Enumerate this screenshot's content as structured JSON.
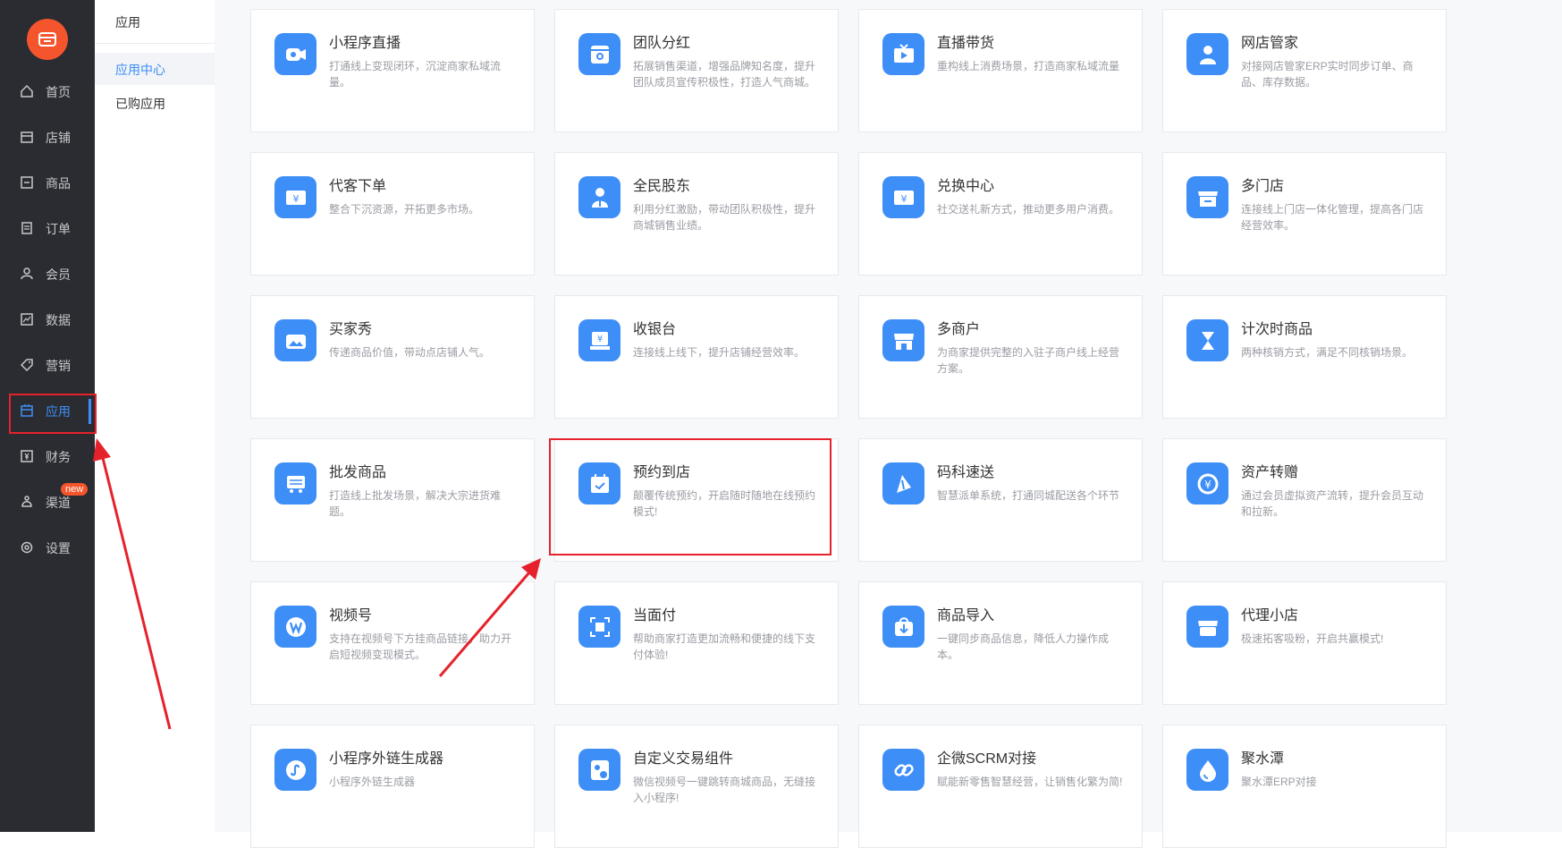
{
  "sidebar": {
    "items": [
      {
        "label": "首页",
        "icon": "home-icon"
      },
      {
        "label": "店铺",
        "icon": "shop-icon"
      },
      {
        "label": "商品",
        "icon": "goods-icon"
      },
      {
        "label": "订单",
        "icon": "order-icon"
      },
      {
        "label": "会员",
        "icon": "user-icon"
      },
      {
        "label": "数据",
        "icon": "data-icon"
      },
      {
        "label": "营销",
        "icon": "tag-icon"
      },
      {
        "label": "应用",
        "icon": "app-icon",
        "active": true
      },
      {
        "label": "财务",
        "icon": "finance-icon"
      },
      {
        "label": "渠道",
        "icon": "channel-icon",
        "badge": "new"
      },
      {
        "label": "设置",
        "icon": "gear-icon"
      }
    ]
  },
  "subnav": {
    "title": "应用",
    "items": [
      {
        "label": "应用中心",
        "active": true
      },
      {
        "label": "已购应用"
      }
    ]
  },
  "apps": [
    {
      "title": "小程序直播",
      "desc": "打通线上变现闭环，沉淀商家私域流量。",
      "icon": "live-camera-icon"
    },
    {
      "title": "团队分红",
      "desc": "拓展销售渠道，增强品牌知名度，提升团队成员宣传积极性，打造人气商城。",
      "icon": "team-bonus-icon"
    },
    {
      "title": "直播带货",
      "desc": "重构线上消费场景，打造商家私域流量",
      "icon": "tv-play-icon"
    },
    {
      "title": "网店管家",
      "desc": "对接网店管家ERP实时同步订单、商品、库存数据。",
      "icon": "manager-icon"
    },
    {
      "title": "代客下单",
      "desc": "整合下沉资源，开拓更多市场。",
      "icon": "ticket-icon"
    },
    {
      "title": "全民股东",
      "desc": "利用分红激励，带动团队积极性，提升商城销售业绩。",
      "icon": "shareholder-icon"
    },
    {
      "title": "兑换中心",
      "desc": "社交送礼新方式，推动更多用户消费。",
      "icon": "exchange-icon"
    },
    {
      "title": "多门店",
      "desc": "连接线上门店一体化管理，提高各门店经营效率。",
      "icon": "store-icon"
    },
    {
      "title": "买家秀",
      "desc": "传递商品价值，带动点店铺人气。",
      "icon": "photo-icon"
    },
    {
      "title": "收银台",
      "desc": "连接线上线下，提升店铺经营效率。",
      "icon": "cashier-icon"
    },
    {
      "title": "多商户",
      "desc": "为商家提供完整的入驻子商户线上经营方案。",
      "icon": "merchant-icon"
    },
    {
      "title": "计次时商品",
      "desc": "两种核销方式，满足不同核销场景。",
      "icon": "hourglass-icon"
    },
    {
      "title": "批发商品",
      "desc": "打造线上批发场景，解决大宗进货难题。",
      "icon": "wholesale-icon"
    },
    {
      "title": "预约到店",
      "desc": "颠覆传统预约，开启随时随地在线预约模式!",
      "icon": "calendar-check-icon"
    },
    {
      "title": "码科速送",
      "desc": "智慧派单系统，打通同城配送各个环节",
      "icon": "delivery-icon"
    },
    {
      "title": "资产转赠",
      "desc": "通过会员虚拟资产流转，提升会员互动和拉新。",
      "icon": "transfer-icon"
    },
    {
      "title": "视频号",
      "desc": "支持在视频号下方挂商品链接，助力开启短视频变现模式。",
      "icon": "video-channel-icon"
    },
    {
      "title": "当面付",
      "desc": "帮助商家打造更加流畅和便捷的线下支付体验!",
      "icon": "scan-pay-icon"
    },
    {
      "title": "商品导入",
      "desc": "一键同步商品信息，降低人力操作成本。",
      "icon": "import-icon"
    },
    {
      "title": "代理小店",
      "desc": "极速拓客吸粉，开启共赢模式!",
      "icon": "agent-store-icon"
    },
    {
      "title": "小程序外链生成器",
      "desc": "小程序外链生成器",
      "icon": "miniprogram-link-icon"
    },
    {
      "title": "自定义交易组件",
      "desc": "微信视频号一键跳转商城商品，无缝接入小程序!",
      "icon": "wechat-component-icon"
    },
    {
      "title": "企微SCRM对接",
      "desc": "赋能新零售智慧经营，让销售化繁为简!",
      "icon": "link-icon"
    },
    {
      "title": "聚水潭",
      "desc": "聚水潭ERP对接",
      "icon": "water-drop-icon"
    }
  ],
  "colors": {
    "sidebar_bg": "#2b2c31",
    "accent": "#3d8ef6",
    "logo": "#f5552c",
    "annotation": "#e5222c"
  }
}
